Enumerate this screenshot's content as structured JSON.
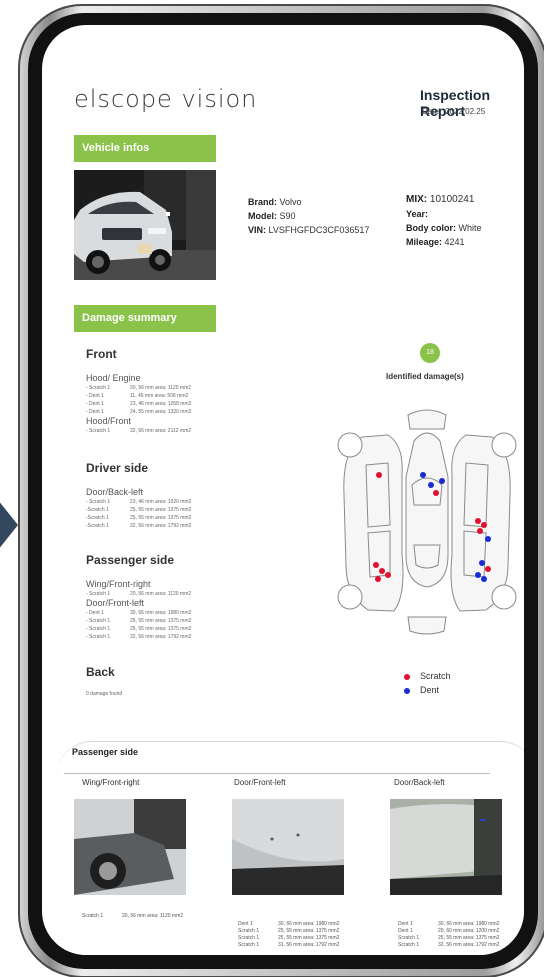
{
  "brand_logo": "elscope vision",
  "report": {
    "title": "Inspection Report",
    "date_label": "Date:",
    "date": "2022.02.25"
  },
  "vehicle": {
    "header": "Vehicle infos",
    "brand_label": "Brand:",
    "brand": "Volvo",
    "model_label": "Model:",
    "model": "S90",
    "vin_label": "VIN:",
    "vin": "LVSFHGFDC3CF036517",
    "mix_label": "MIX:",
    "mix": "10100241",
    "year_label": "Year:",
    "year": "",
    "color_label": "Body color:",
    "color": "White",
    "mileage_label": "Mileage:",
    "mileage": "4241"
  },
  "summary": {
    "header": "Damage summary",
    "front": {
      "title": "Front",
      "groups": [
        {
          "name": "Hood/ Engine",
          "items": [
            {
              "type": "- Scratch 1",
              "desc": "20, 56 mm area: 1120 mm2"
            },
            {
              "type": "- Dent 1",
              "desc": "11, 46 mm area: 506 mm2"
            },
            {
              "type": "- Dent 1",
              "desc": "23, 46 mm area: 1058 mm2"
            },
            {
              "type": "- Dent 1",
              "desc": "24, 55 mm area: 1320 mm2"
            }
          ]
        },
        {
          "name": "Hood/Front",
          "items": [
            {
              "type": "- Scratch 1",
              "desc": "32, 66 mm area: 2112 mm2"
            }
          ]
        }
      ]
    },
    "driver": {
      "title": "Driver side",
      "groups": [
        {
          "name": "Door/Back-left",
          "items": [
            {
              "type": "- Scratch 1",
              "desc": "23, 46 mm area: 1020 mm2"
            },
            {
              "type": "-Scratch 1",
              "desc": "25, 55 mm area: 1375 mm2"
            },
            {
              "type": "-Scratch 1",
              "desc": "25, 55 mm area: 1375 mm2"
            },
            {
              "type": "-Scratch 1",
              "desc": "32, 56 mm area: 1792 mm2"
            }
          ]
        }
      ]
    },
    "passenger": {
      "title": "Passenger side",
      "groups": [
        {
          "name": "Wing/Front-right",
          "items": [
            {
              "type": "- Scratch 1",
              "desc": "20, 56 mm area: 1120 mm2"
            }
          ]
        },
        {
          "name": "Door/Front-left",
          "items": [
            {
              "type": "- Dent 1",
              "desc": "30, 66 mm area: 1980 mm2"
            },
            {
              "type": "- Scratch 1",
              "desc": "25, 55 mm area: 1375 mm2"
            },
            {
              "type": "- Scratch 1",
              "desc": "25, 55 mm area: 1375 mm2"
            },
            {
              "type": "- Scratch 1",
              "desc": "32, 56 mm area: 1792 mm2"
            }
          ]
        }
      ]
    },
    "back": {
      "title": "Back",
      "note": "0 damage found"
    }
  },
  "diagram": {
    "count": "18",
    "label": "Identified damage(s)",
    "legend": [
      {
        "label": "Scratch",
        "color": "#e0102e"
      },
      {
        "label": "Dent",
        "color": "#1a2bd6"
      }
    ]
  },
  "passenger_panel": {
    "title": "Passenger side",
    "columns": [
      {
        "title": "Wing/Front-right",
        "notes": [
          {
            "type": "Scratch 1",
            "desc": "20, 56 mm area: 1120 mm2"
          }
        ]
      },
      {
        "title": "Door/Front-left",
        "notes": [
          {
            "type": "Dent 1",
            "desc": "30, 66 mm area: 1980 mm2"
          },
          {
            "type": "Scratch 1",
            "desc": "25, 55 mm area: 1375 mm2"
          },
          {
            "type": "Scratch 1",
            "desc": "25, 55 mm area: 1375 mm2"
          },
          {
            "type": "Scratch 1",
            "desc": "31, 56 mm area: 1792 mm2"
          }
        ]
      },
      {
        "title": "Door/Back-left",
        "notes": [
          {
            "type": "Dent 1",
            "desc": "30, 66 mm area: 1980 mm2"
          },
          {
            "type": "Dent 1",
            "desc": "20, 60 mm area: 1200 mm2"
          },
          {
            "type": "Scratch 1",
            "desc": "25, 55 mm area: 1375 mm2"
          },
          {
            "type": "Scratch 1",
            "desc": "32, 56 mm area: 1792 mm2"
          }
        ]
      }
    ]
  }
}
